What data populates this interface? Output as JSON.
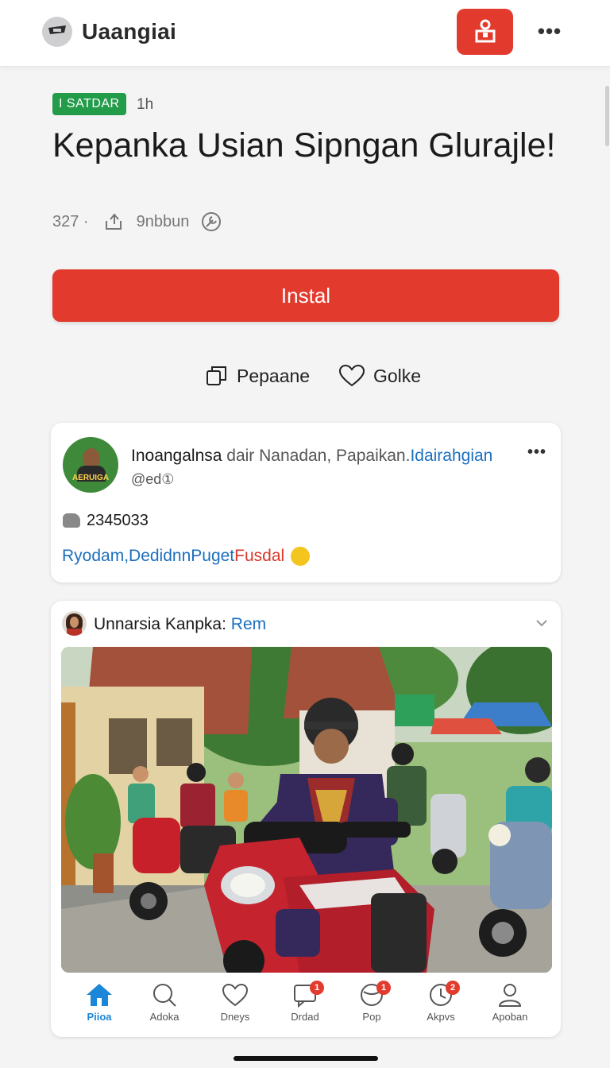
{
  "header": {
    "app_title": "Uaangiai",
    "logo_icon": "app-logo-icon",
    "action_icon": "briefcase-icon",
    "more_label": "•••"
  },
  "article": {
    "badge": "I SATDAR",
    "age": "1h",
    "headline": "Kepanka Usian Sipngan Glurajle!",
    "meta_count": "327 ·",
    "meta_label": "9nbbun",
    "install_label": "Instal",
    "action_share": "Pepaane",
    "action_like": "Golke"
  },
  "post": {
    "avatar_tag": "AERUIGA",
    "name": "Inoangalnsa",
    "name_mid": " dair Nanadan, Papaikan.",
    "name_link": "Idairahgian",
    "handle": "@ed①",
    "more_label": "•••",
    "count": "2345033",
    "tag1": "Ryodam, ",
    "tag2": "DedidnnPuget ",
    "tag3": "Fusdal"
  },
  "post2": {
    "title": "Unnarsia Kanpka: ",
    "title_link": "Rem"
  },
  "bottom_nav": {
    "items": [
      {
        "label": "Piioa",
        "icon": "home-icon",
        "badge": ""
      },
      {
        "label": "Adoka",
        "icon": "search-icon",
        "badge": ""
      },
      {
        "label": "Dneys",
        "icon": "heart-icon",
        "badge": ""
      },
      {
        "label": "Drdad",
        "icon": "chat-icon",
        "badge": "1"
      },
      {
        "label": "Pop",
        "icon": "globe-icon",
        "badge": "1"
      },
      {
        "label": "Akpvs",
        "icon": "clock-icon",
        "badge": "2"
      },
      {
        "label": "Apoban",
        "icon": "profile-icon",
        "badge": ""
      }
    ]
  },
  "colors": {
    "accent_red": "#e23b2e",
    "badge_green": "#239c4a",
    "link_blue": "#1c6fbf",
    "nav_active": "#1c86d9"
  }
}
